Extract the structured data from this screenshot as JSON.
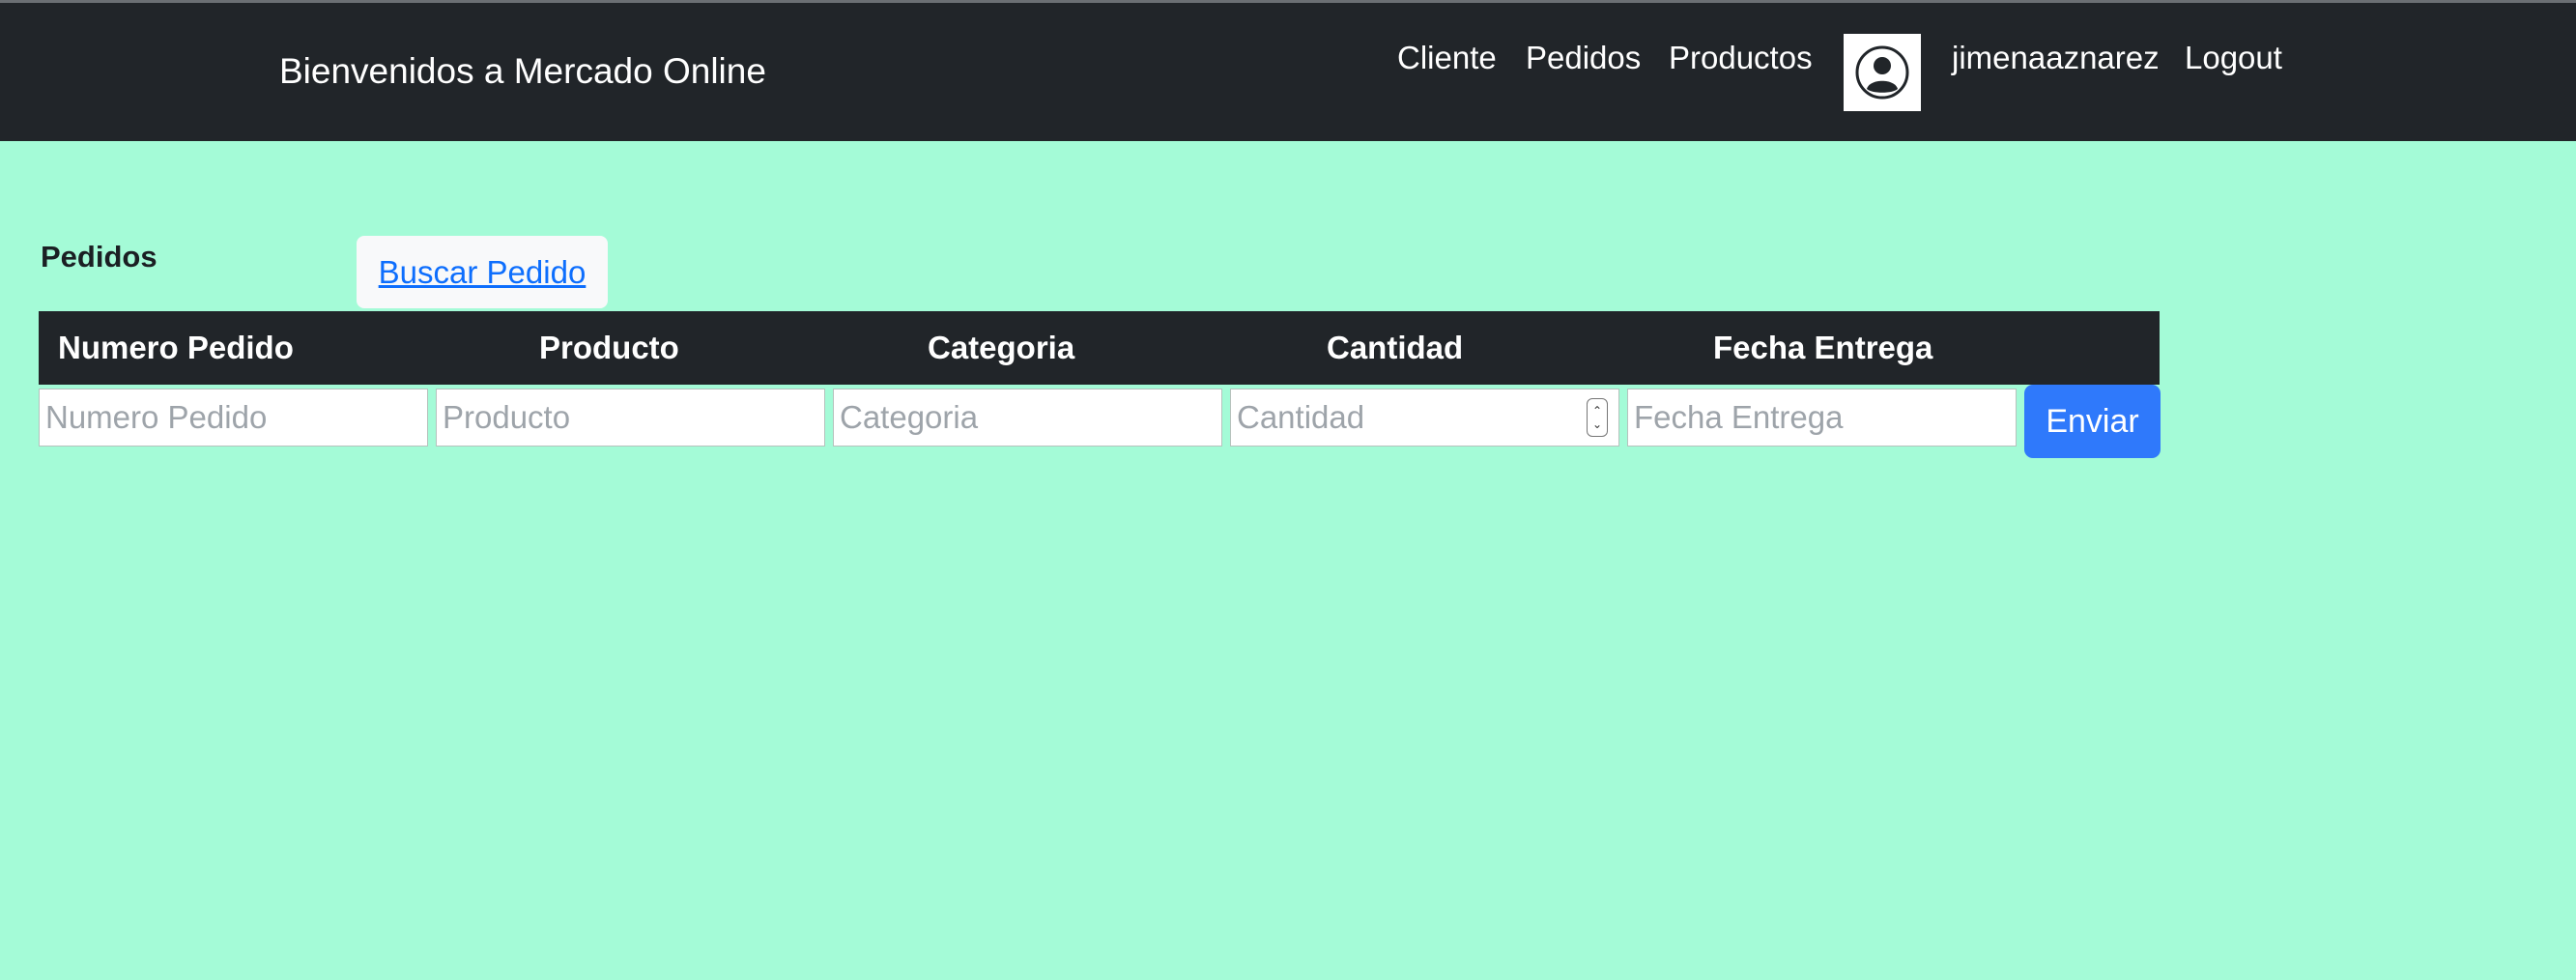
{
  "navbar": {
    "brand": "Bienvenidos a Mercado Online",
    "links": [
      "Cliente",
      "Pedidos",
      "Productos"
    ],
    "username": "jimenaaznarez",
    "logout": "Logout",
    "avatar_icon": "user-circle-icon"
  },
  "page": {
    "title": "Pedidos",
    "search_link": "Buscar Pedido"
  },
  "table": {
    "headers": [
      "Numero Pedido",
      "Producto",
      "Categoria",
      "Cantidad",
      "Fecha Entrega"
    ],
    "placeholders": [
      "Numero Pedido",
      "Producto",
      "Categoria",
      "Cantidad",
      "Fecha Entrega"
    ],
    "values": [
      "",
      "",
      "",
      "",
      ""
    ],
    "submit_label": "Enviar"
  },
  "colors": {
    "navbar": "#212529",
    "background": "#a4fbd7",
    "primary_button": "#2f79fb",
    "link": "#0d6efd"
  }
}
